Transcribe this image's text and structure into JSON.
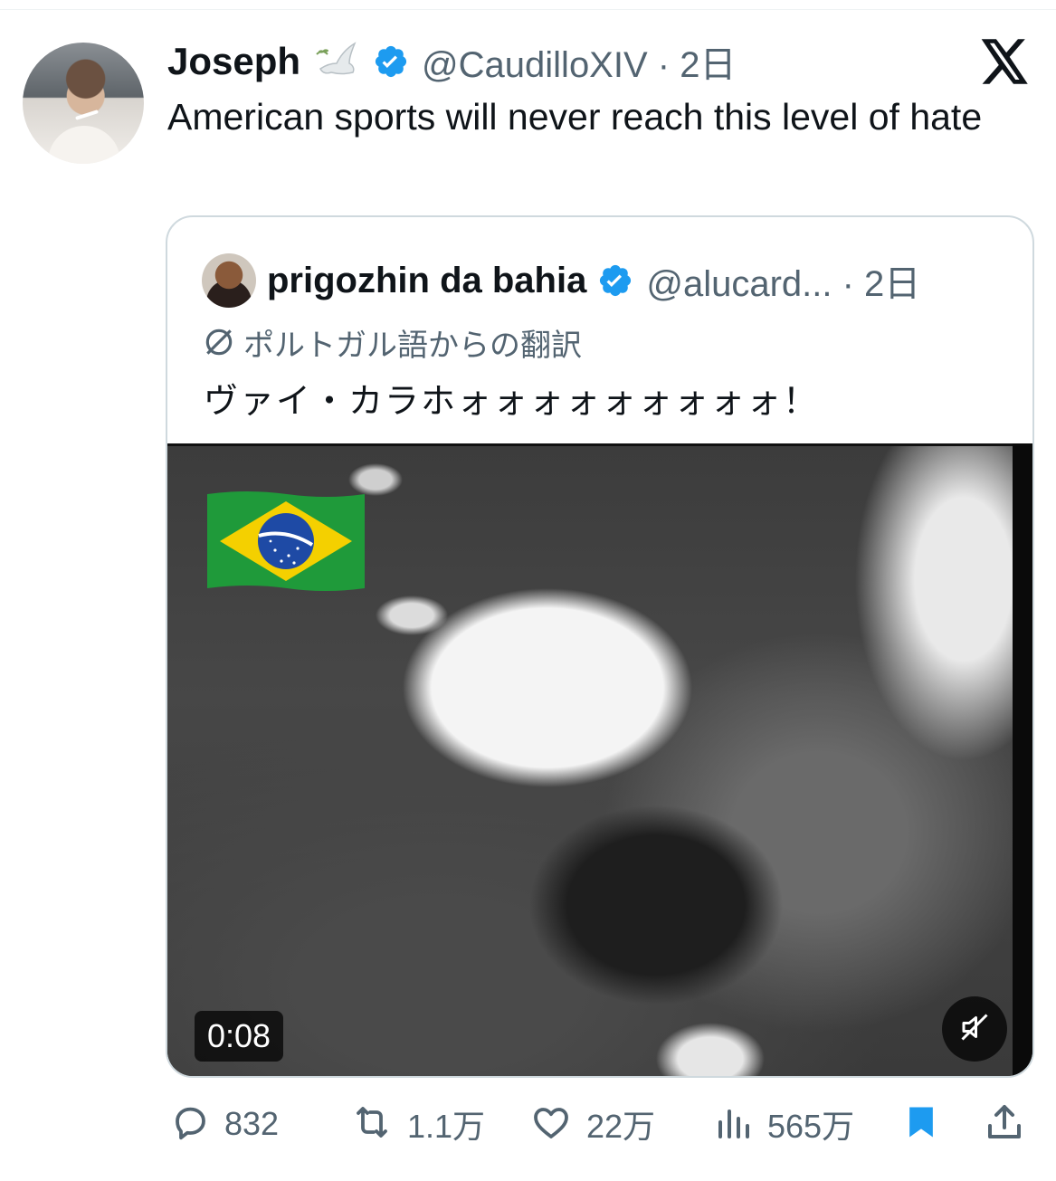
{
  "post": {
    "author_name": "Joseph",
    "handle_and_time": "@CaudilloXIV · 2日",
    "text": "American sports will never reach this level of hate"
  },
  "quote": {
    "author_name": "prigozhin da bahia",
    "handle_and_time": "@alucard... · 2日",
    "translation_label": "ポルトガル語からの翻訳",
    "text": "ヴァイ・カラホォォォォォォォォォ！",
    "video": {
      "timestamp": "0:08",
      "muted": true
    }
  },
  "actions": {
    "replies": "832",
    "reposts": "1.1万",
    "likes": "22万",
    "views": "565万"
  },
  "colors": {
    "verified": "#1d9bf0",
    "secondary_text": "#536471",
    "bookmark": "#1d9bf0"
  },
  "icons": [
    "dove-icon",
    "verified-icon",
    "x-logo-icon",
    "translate-icon",
    "mute-icon",
    "reply-icon",
    "repost-icon",
    "like-icon",
    "views-icon",
    "bookmark-icon",
    "share-icon"
  ]
}
